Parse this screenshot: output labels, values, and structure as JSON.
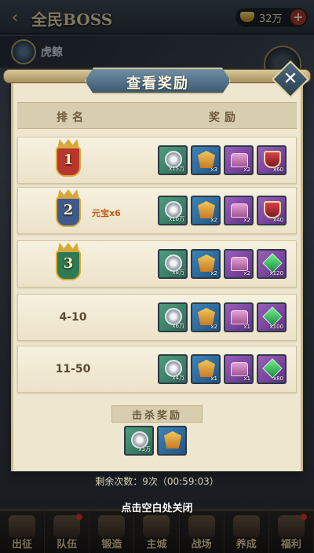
{
  "screen": {
    "title": "全民BOSS",
    "currency": "32万",
    "boss_name": "虎鲸",
    "reward_corner_label": "奖励",
    "remaining": "剩余次数：9次（00:59:03）",
    "close_hint": "点击空白处关闭"
  },
  "modal": {
    "title": "查看奖励",
    "header_rank": "排名",
    "header_reward": "奖励",
    "rows": [
      {
        "rank": "1",
        "extra": "",
        "items": [
          {
            "icon": "silver-coin-icon",
            "qty": "x15万"
          },
          {
            "icon": "emblem-icon",
            "qty": "x3"
          },
          {
            "icon": "chest-icon",
            "qty": "x2"
          },
          {
            "icon": "red-shield-icon",
            "qty": "x60"
          }
        ]
      },
      {
        "rank": "2",
        "extra": "元宝x6",
        "items": [
          {
            "icon": "silver-coin-icon",
            "qty": "x10万"
          },
          {
            "icon": "emblem-icon",
            "qty": "x2"
          },
          {
            "icon": "chest-icon",
            "qty": "x2"
          },
          {
            "icon": "red-shield-icon",
            "qty": "x40"
          }
        ]
      },
      {
        "rank": "3",
        "extra": "",
        "items": [
          {
            "icon": "silver-coin-icon",
            "qty": "x8万"
          },
          {
            "icon": "emblem-icon",
            "qty": "x2"
          },
          {
            "icon": "chest-icon",
            "qty": "x2"
          },
          {
            "icon": "green-gem-icon",
            "qty": "x120"
          }
        ]
      },
      {
        "rank": "4-10",
        "extra": "",
        "items": [
          {
            "icon": "silver-coin-icon",
            "qty": "x6万"
          },
          {
            "icon": "emblem-icon",
            "qty": "x2"
          },
          {
            "icon": "chest-icon",
            "qty": "x1"
          },
          {
            "icon": "green-gem-icon",
            "qty": "x100"
          }
        ]
      },
      {
        "rank": "11-50",
        "extra": "",
        "items": [
          {
            "icon": "silver-coin-icon",
            "qty": "x4万"
          },
          {
            "icon": "emblem-icon",
            "qty": "x1"
          },
          {
            "icon": "chest-icon",
            "qty": "x1"
          },
          {
            "icon": "green-gem-icon",
            "qty": "x80"
          }
        ]
      }
    ],
    "kill_title": "击杀奖励",
    "kill_items": [
      {
        "icon": "silver-coin-icon",
        "qty": "x3万"
      },
      {
        "icon": "emblem-icon",
        "qty": ""
      }
    ]
  },
  "nav": [
    {
      "label": "出征"
    },
    {
      "label": "队伍"
    },
    {
      "label": "锻造"
    },
    {
      "label": "主城"
    },
    {
      "label": "战场"
    },
    {
      "label": "养成"
    },
    {
      "label": "福利"
    }
  ],
  "colors": {
    "medal_gold": "#c7352b",
    "medal_silver": "#3f5a8a",
    "medal_bronze": "#2f7a52"
  }
}
